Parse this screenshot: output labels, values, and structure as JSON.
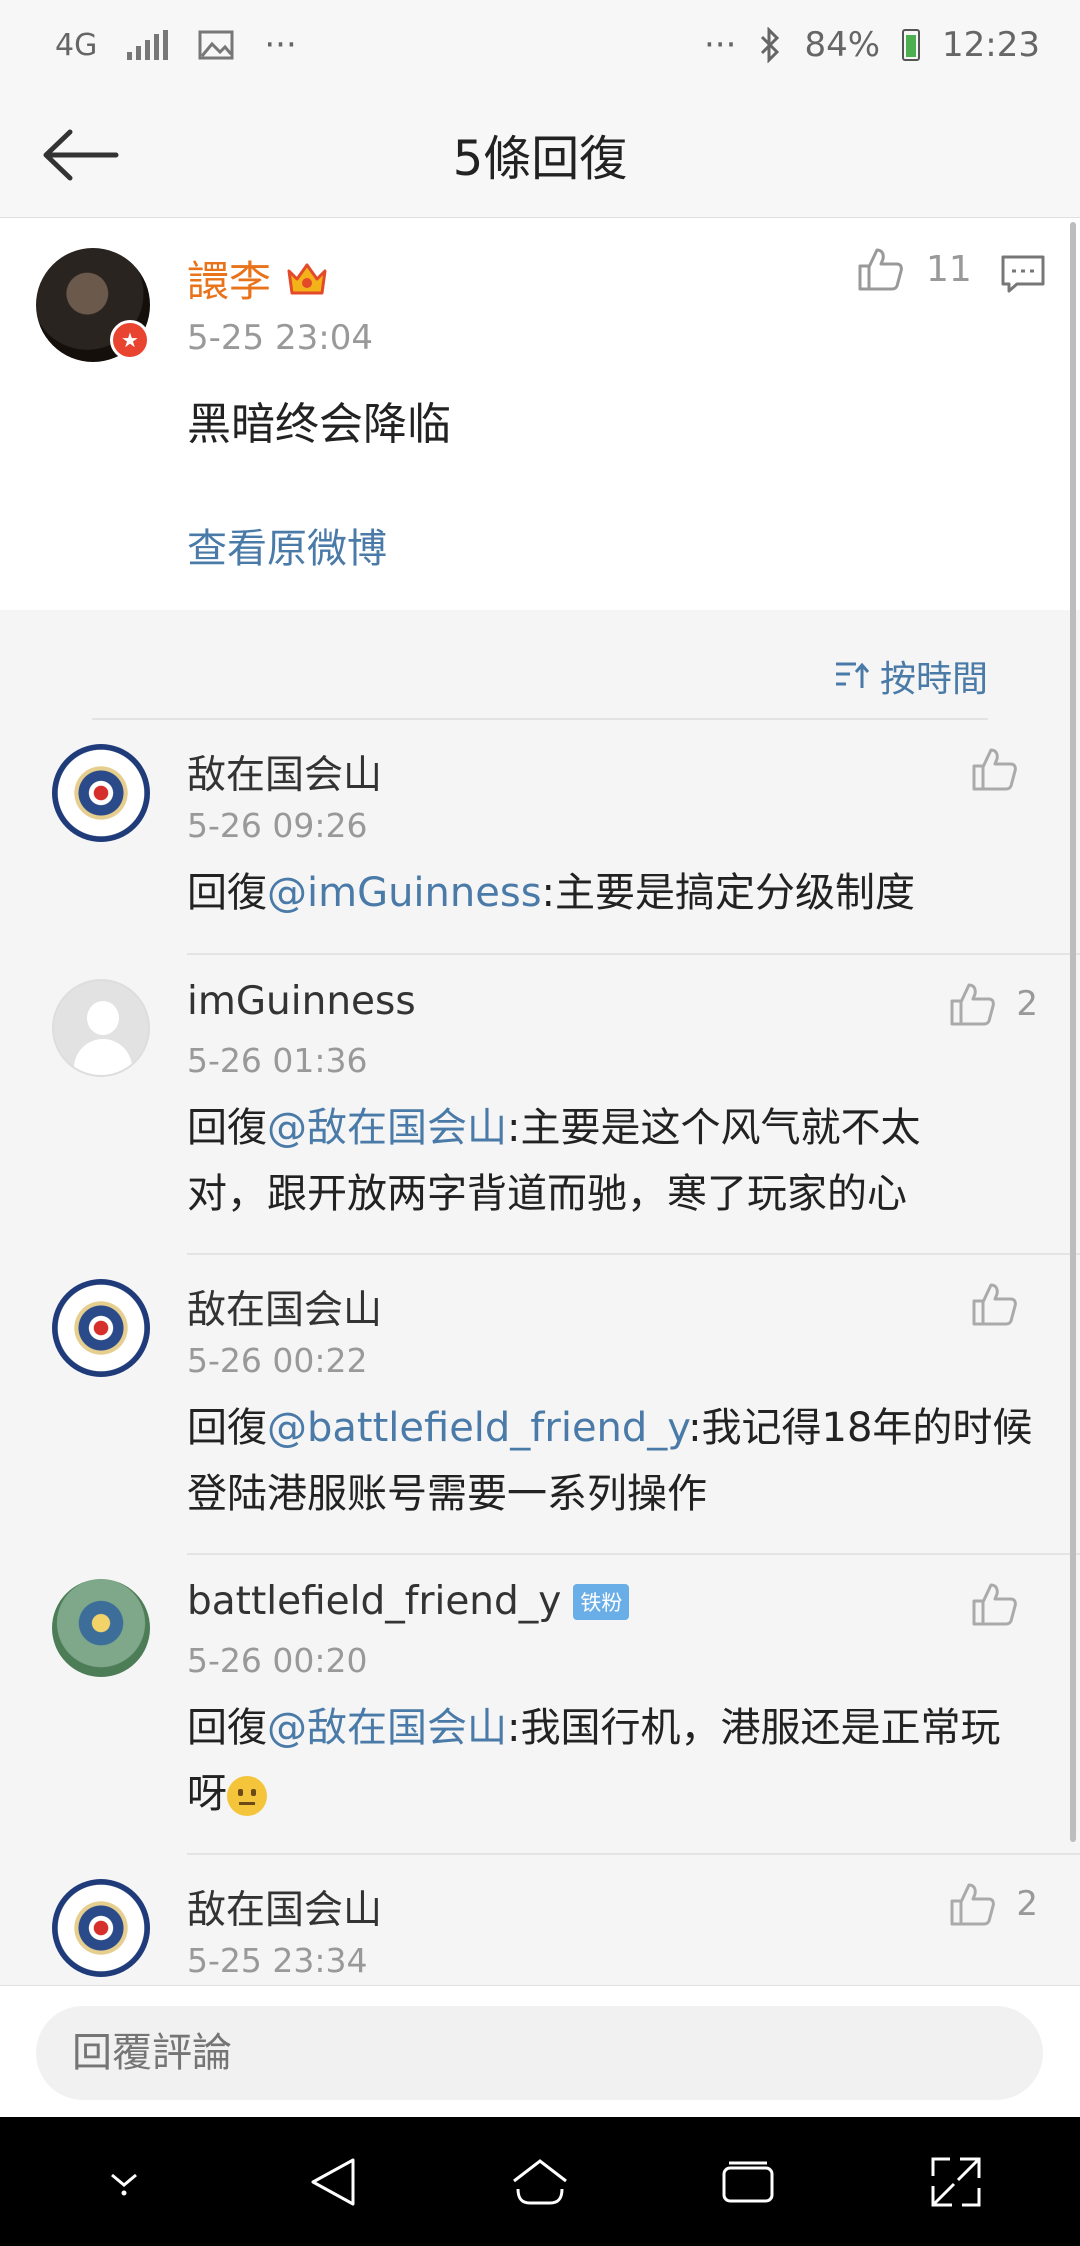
{
  "status": {
    "network": "4G",
    "more_left": "···",
    "more_right": "···",
    "battery": "84%",
    "time": "12:23"
  },
  "header": {
    "title": "5條回復"
  },
  "post": {
    "user": "譞李",
    "time": "5-25 23:04",
    "text": "黑暗终会降临",
    "view_original": "查看原微博",
    "like_count": "11"
  },
  "sort": {
    "label": "按時間"
  },
  "comments": [
    {
      "user": "敌在国会山",
      "time": "5-26 09:26",
      "prefix": "回復",
      "mention": "@imGuinness",
      "body": ":主要是搞定分级制度",
      "like_count": ""
    },
    {
      "user": "imGuinness",
      "time": "5-26 01:36",
      "prefix": "回復",
      "mention": "@敌在国会山",
      "body": ":主要是这个风气就不太对，跟开放两字背道而驰，寒了玩家的心",
      "like_count": "2"
    },
    {
      "user": "敌在国会山",
      "time": "5-26 00:22",
      "prefix": "回復",
      "mention": "@battlefield_friend_y",
      "body": ":我记得18年的时候登陆港服账号需要一系列操作",
      "like_count": ""
    },
    {
      "user": "battlefield_friend_y",
      "badge": "铁粉",
      "time": "5-26 00:20",
      "prefix": "回復",
      "mention": "@敌在国会山",
      "body": ":我国行机，港服还是正常玩呀",
      "like_count": ""
    },
    {
      "user": "敌在国会山",
      "time": "5-25 23:34",
      "like_count": "2"
    }
  ],
  "reply": {
    "placeholder": "回覆評論"
  },
  "colors": {
    "link": "#4a7aa8",
    "username_vip": "#e8731a",
    "badge": "#6aaee8"
  }
}
